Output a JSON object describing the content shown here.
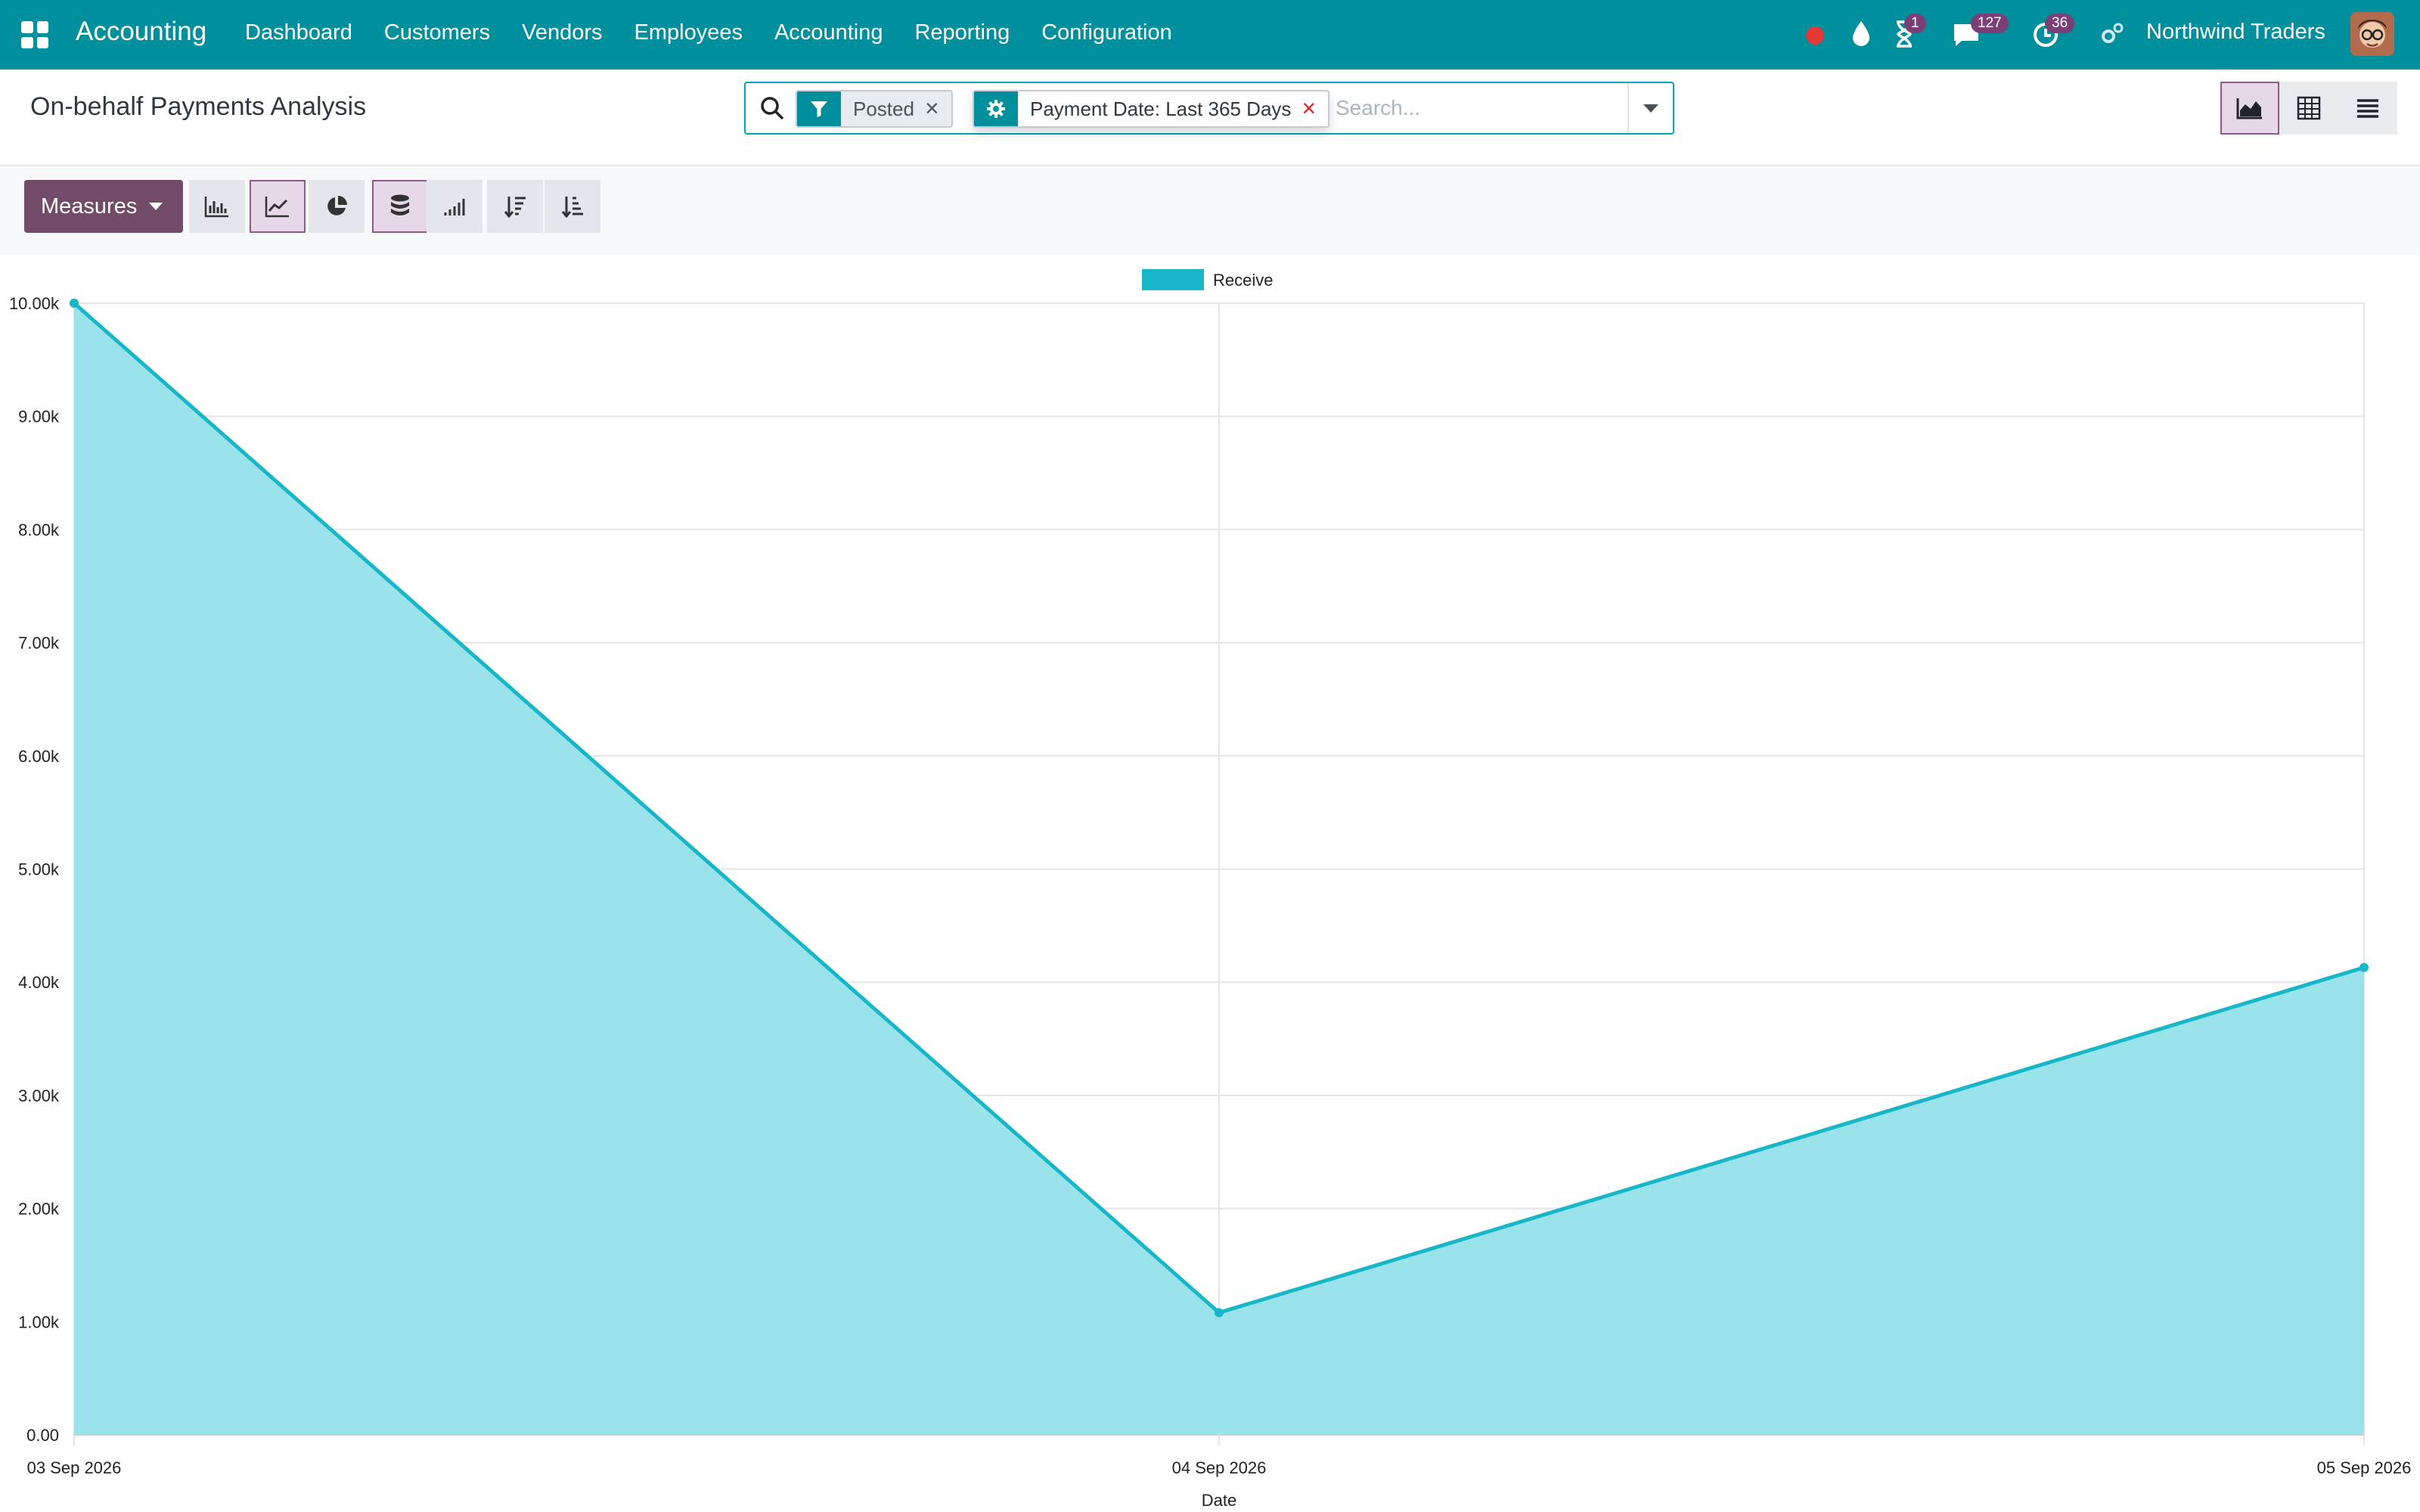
{
  "navbar": {
    "app_title": "Accounting",
    "menu": [
      "Dashboard",
      "Customers",
      "Vendors",
      "Employees",
      "Accounting",
      "Reporting",
      "Configuration"
    ],
    "badges": {
      "activities": "1",
      "messages": "127",
      "timers": "36"
    },
    "company": "Northwind Traders"
  },
  "control_panel": {
    "title": "On-behalf Payments Analysis",
    "facets": [
      {
        "icon": "filter-icon",
        "label": "Posted"
      },
      {
        "icon": "gear-icon",
        "label": "Payment Date: Last 365 Days"
      }
    ],
    "search_placeholder": "Search...",
    "views": [
      "graph-view",
      "pivot-view",
      "list-view"
    ],
    "active_view": "graph-view"
  },
  "toolbar": {
    "measures_label": "Measures",
    "buttons": [
      "bar-chart-icon",
      "line-chart-icon",
      "pie-chart-icon",
      "stacked-icon",
      "cumulative-icon",
      "sort-descending-icon",
      "sort-ascending-icon"
    ],
    "active": [
      "line-chart-icon",
      "stacked-icon"
    ]
  },
  "chart_data": {
    "type": "area",
    "categories": [
      "03 Sep 2026",
      "04 Sep 2026",
      "05 Sep 2026"
    ],
    "series": [
      {
        "name": "Receive",
        "values": [
          10000,
          1080,
          4130
        ],
        "color": "#17b6c8",
        "fill": "#9be3ea"
      }
    ],
    "xlabel": "Date",
    "ylabel": "",
    "ylim": [
      0,
      10000
    ],
    "yticks": [
      0,
      1000,
      2000,
      3000,
      4000,
      5000,
      6000,
      7000,
      8000,
      9000,
      10000
    ],
    "ytick_labels": [
      "0.00",
      "1.00k",
      "2.00k",
      "3.00k",
      "4.00k",
      "5.00k",
      "6.00k",
      "7.00k",
      "8.00k",
      "9.00k",
      "10.00k"
    ],
    "grid": true,
    "legend": "top"
  }
}
